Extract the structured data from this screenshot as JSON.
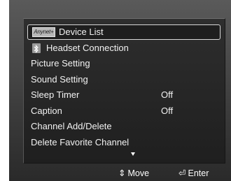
{
  "menu": {
    "items": [
      {
        "label": "Device List",
        "badge": "Anynet+",
        "selected": true
      },
      {
        "label": "Headset Connection",
        "icon": "bluetooth-icon"
      },
      {
        "label": "Picture Setting"
      },
      {
        "label": "Sound Setting"
      },
      {
        "label": "Sleep Timer",
        "value": "Off"
      },
      {
        "label": "Caption",
        "value": "Off"
      },
      {
        "label": "Channel Add/Delete"
      },
      {
        "label": "Delete Favorite Channel"
      }
    ],
    "more_indicator": "▼"
  },
  "footer": {
    "move_icon": "⇕",
    "move_label": "Move",
    "enter_icon": "⏎",
    "enter_label": "Enter"
  }
}
